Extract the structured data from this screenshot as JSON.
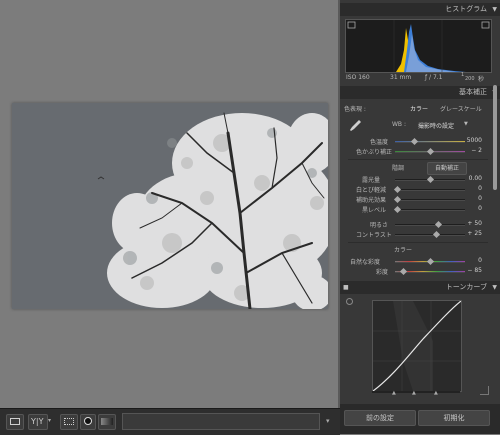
{
  "histogram": {
    "header": "ヒストグラム",
    "iso": "ISO 160",
    "focal": "31 mm",
    "aperture": "ƒ / 7.1",
    "shutter_num": "1",
    "shutter_den": "200",
    "shutter_unit": "秒"
  },
  "basic": {
    "header": "基本補正",
    "treatment_label": "色表現 :",
    "color_btn": "カラー",
    "gray_btn": "グレースケール",
    "wb_label": "WB :",
    "wb_value": "撮影時の設定",
    "temp_label": "色温度",
    "temp_value": "5000",
    "tint_label": "色かぶり補正",
    "tint_value": "− 2",
    "tone_label": "階調",
    "auto_btn": "自動補正",
    "exposure_label": "露光量",
    "exposure_value": "0.00",
    "whites_label": "白とび軽減",
    "whites_value": "0",
    "fill_label": "補助光効果",
    "fill_value": "0",
    "blacks_label": "黒レベル",
    "blacks_value": "0",
    "brightness_label": "明るさ",
    "brightness_value": "+ 50",
    "contrast_label": "コントラスト",
    "contrast_value": "+ 25",
    "presence_label": "カラー",
    "vibrance_label": "自然な彩度",
    "vibrance_value": "0",
    "saturation_label": "彩度",
    "saturation_value": "− 85"
  },
  "tone_curve": {
    "header": "トーンカーブ"
  },
  "buttons": {
    "previous": "前の設定",
    "reset": "初期化"
  },
  "colors": {
    "panel": "#383838",
    "header": "#2b2b2b",
    "accent": "#d8c050"
  }
}
